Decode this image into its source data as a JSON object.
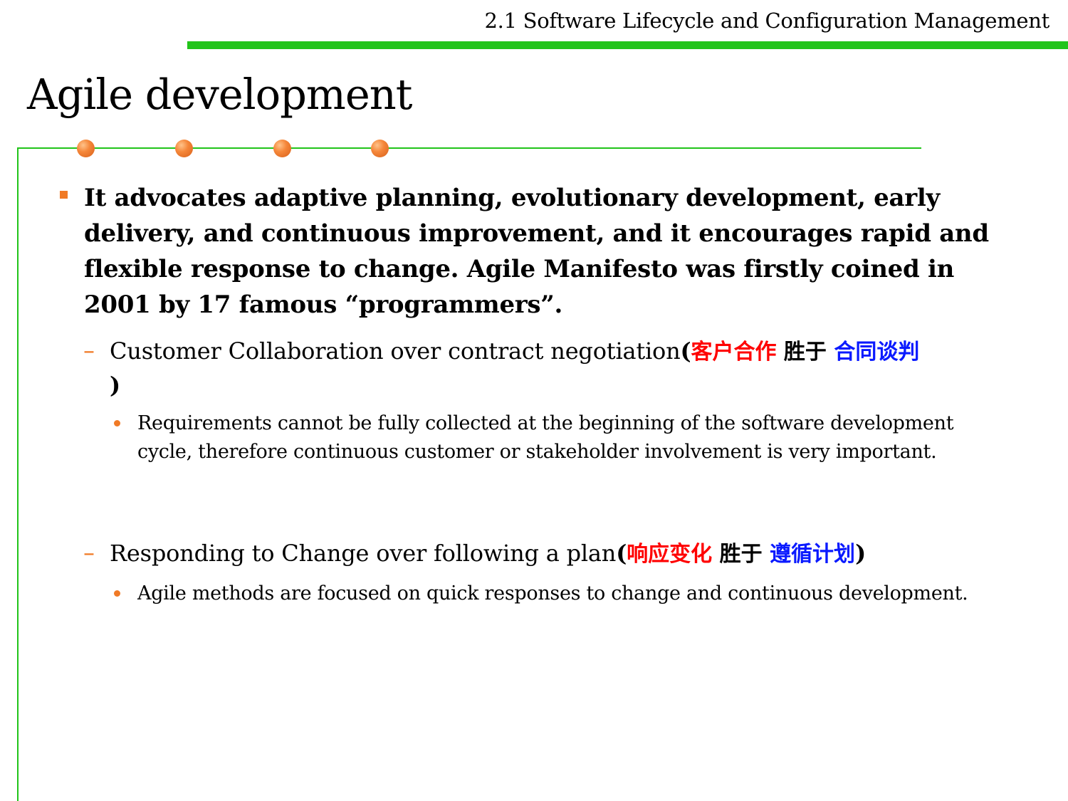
{
  "header": {
    "section_title": "2.1 Software Lifecycle and Configuration Management"
  },
  "slide": {
    "title": "Agile development"
  },
  "bullets": {
    "main": "It advocates adaptive planning, evolutionary development, early delivery, and continuous improvement, and it encourages rapid and flexible response to change. Agile Manifesto was firstly coined in 2001 by 17 famous “programmers”.",
    "sub1": {
      "text": "Customer Collaboration over contract negotiation",
      "open_paren": "(",
      "cn_value": "客户合作",
      "cn_over": " 胜于 ",
      "cn_instead": "合同谈判",
      "close_paren": ")",
      "detail": "Requirements cannot be fully collected at the beginning of the software development cycle, therefore continuous customer or stakeholder involvement is very important."
    },
    "sub2": {
      "text": "Responding to Change over following a plan",
      "open_paren": "(",
      "cn_value": "响应变化",
      "cn_over": " 胜于 ",
      "cn_instead": "遵循计划",
      "close_paren": ")",
      "detail": "Agile methods are focused on quick responses to change and continuous development."
    }
  },
  "colors": {
    "accent_green": "#22c41a",
    "bullet_orange": "#f07a26",
    "cn_red": "#ff0000",
    "cn_blue": "#0a1aff"
  }
}
